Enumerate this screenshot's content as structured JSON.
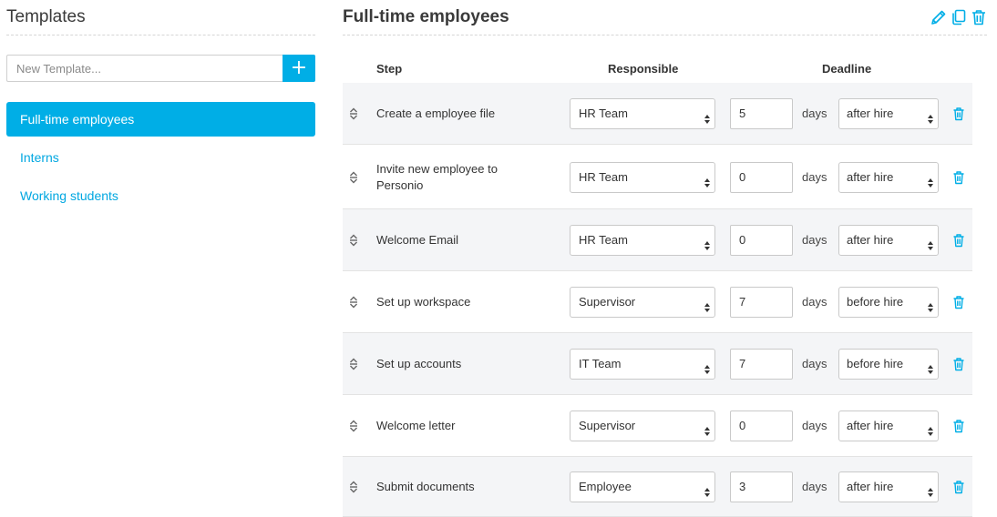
{
  "sidebar": {
    "title": "Templates",
    "new_template_placeholder": "New Template...",
    "add_button": "+",
    "items": [
      {
        "label": "Full-time employees",
        "active": true
      },
      {
        "label": "Interns",
        "active": false
      },
      {
        "label": "Working students",
        "active": false
      }
    ]
  },
  "main": {
    "title": "Full-time employees",
    "actions": [
      "pencil-icon",
      "copy-icon",
      "trash-icon"
    ],
    "columns": {
      "step": "Step",
      "responsible": "Responsible",
      "deadline": "Deadline"
    },
    "days_unit": "days",
    "rows": [
      {
        "step": "Create a employee file",
        "responsible": "HR Team",
        "days": "5",
        "when": "after hire"
      },
      {
        "step": "Invite new employee to Personio",
        "responsible": "HR Team",
        "days": "0",
        "when": "after hire"
      },
      {
        "step": "Welcome Email",
        "responsible": "HR Team",
        "days": "0",
        "when": "after hire"
      },
      {
        "step": "Set up workspace",
        "responsible": "Supervisor",
        "days": "7",
        "when": "before hire"
      },
      {
        "step": "Set up accounts",
        "responsible": "IT Team",
        "days": "7",
        "when": "before hire"
      },
      {
        "step": "Welcome letter",
        "responsible": "Supervisor",
        "days": "0",
        "when": "after hire"
      },
      {
        "step": "Submit documents",
        "responsible": "Employee",
        "days": "3",
        "when": "after hire"
      }
    ]
  },
  "colors": {
    "accent": "#00aee6",
    "link": "#00a7e1",
    "row_shade": "#f4f5f7"
  }
}
